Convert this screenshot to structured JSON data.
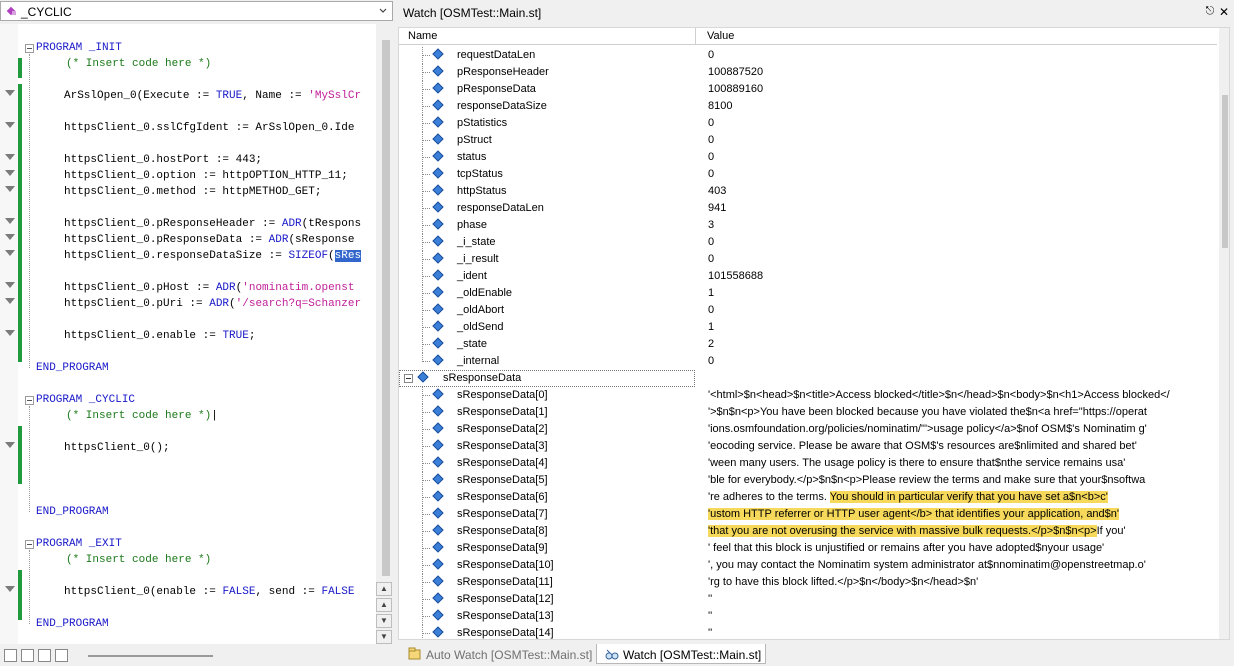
{
  "editor": {
    "combo_value": "_CYCLIC",
    "code": {
      "prog_init": "PROGRAM _INIT",
      "comment": "(* Insert code here *)",
      "l_sslopen": [
        "ArSslOpen_0(Execute := ",
        "TRUE",
        ", Name := ",
        "'MySslCr"
      ],
      "l_cfgident": "httpsClient_0.sslCfgIdent := ArSslOpen_0.Ide",
      "l_hostport": "httpsClient_0.hostPort := 443;",
      "l_option": "httpsClient_0.option := httpOPTION_HTTP_11;",
      "l_method": "httpsClient_0.method := httpMETHOD_GET;",
      "l_resphdr": [
        "httpsClient_0.pResponseHeader := ",
        "ADR",
        "(tRespons"
      ],
      "l_respdata": [
        "httpsClient_0.pResponseData := ",
        "ADR",
        "(sResponse"
      ],
      "l_respsize": [
        "httpsClient_0.responseDataSize := ",
        "SIZEOF",
        "(",
        "sRes"
      ],
      "l_phost": [
        "httpsClient_0.pHost := ",
        "ADR",
        "(",
        "'nominatim.openst"
      ],
      "l_puri": [
        "httpsClient_0.pUri := ",
        "ADR",
        "(",
        "'/search?q=Schanzer"
      ],
      "l_enable": [
        "httpsClient_0.enable := ",
        "TRUE",
        ";"
      ],
      "end_program": "END_PROGRAM",
      "prog_cyclic": "PROGRAM _CYCLIC",
      "l_call": "httpsClient_0();",
      "prog_exit": "PROGRAM _EXIT",
      "l_exit": [
        "httpsClient_0(enable := ",
        "FALSE",
        ", send := ",
        "FALSE"
      ]
    }
  },
  "watch": {
    "title": "Watch [OSMTest::Main.st]",
    "col_name": "Name",
    "col_value": "Value",
    "group_name": "sResponseData",
    "fields": [
      {
        "name": "requestDataLen",
        "value": "0"
      },
      {
        "name": "pResponseHeader",
        "value": "100887520"
      },
      {
        "name": "pResponseData",
        "value": "100889160"
      },
      {
        "name": "responseDataSize",
        "value": "8100"
      },
      {
        "name": "pStatistics",
        "value": "0"
      },
      {
        "name": "pStruct",
        "value": "0"
      },
      {
        "name": "status",
        "value": "0"
      },
      {
        "name": "tcpStatus",
        "value": "0"
      },
      {
        "name": "httpStatus",
        "value": "403"
      },
      {
        "name": "responseDataLen",
        "value": "941"
      },
      {
        "name": "phase",
        "value": "3"
      },
      {
        "name": "_i_state",
        "value": "0"
      },
      {
        "name": "_i_result",
        "value": "0"
      },
      {
        "name": "_ident",
        "value": "101558688"
      },
      {
        "name": "_oldEnable",
        "value": "1"
      },
      {
        "name": "_oldAbort",
        "value": "0"
      },
      {
        "name": "_oldSend",
        "value": "1"
      },
      {
        "name": "_state",
        "value": "2"
      },
      {
        "name": "_internal",
        "value": "0"
      }
    ],
    "resp": [
      {
        "name": "sResponseData[0]",
        "value": "'<html>$n<head>$n<title>Access blocked</title>$n</head>$n<body>$n<h1>Access blocked</",
        "hl": ""
      },
      {
        "name": "sResponseData[1]",
        "value": "'>$n$n<p>You have been blocked because you have violated the$n<a href=\"https://operat",
        "hl": ""
      },
      {
        "name": "sResponseData[2]",
        "value": "'ions.osmfoundation.org/policies/nominatim/\"'>usage policy</a>$nof OSM$'s Nominatim g'",
        "hl": ""
      },
      {
        "name": "sResponseData[3]",
        "value": "'eocoding service. Please be aware that OSM$'s resources are$nlimited and shared bet'",
        "hl": ""
      },
      {
        "name": "sResponseData[4]",
        "value": "'ween many users. The usage policy is there to ensure that$nthe service remains usa'",
        "hl": ""
      },
      {
        "name": "sResponseData[5]",
        "value": "'ble for everybody.</p>$n$n<p>Please review the terms and make sure that your$nsoftwa",
        "hl": ""
      },
      {
        "name": "sResponseData[6]",
        "value": "'re adheres to the terms. ",
        "hl": "You should in particular verify that you have set a$n<b>c'"
      },
      {
        "name": "sResponseData[7]",
        "value": "",
        "hl": "'ustom HTTP referrer or HTTP user agent</b> that identifies your application, and$n'"
      },
      {
        "name": "sResponseData[8]",
        "value": "",
        "hl": "'that you are not overusing the service with massive bulk requests.</p>$n$n<p>",
        "tail": "If you'"
      },
      {
        "name": "sResponseData[9]",
        "value": "' feel that this block is unjustified or remains after you have adopted$nyour usage'",
        "hl": ""
      },
      {
        "name": "sResponseData[10]",
        "value": "', you may contact the Nominatim system administrator at$nnominatim@openstreetmap.o'",
        "hl": ""
      },
      {
        "name": "sResponseData[11]",
        "value": "'rg to have this block lifted.</p>$n</body>$n</head>$n'",
        "hl": ""
      },
      {
        "name": "sResponseData[12]",
        "value": "''",
        "hl": ""
      },
      {
        "name": "sResponseData[13]",
        "value": "''",
        "hl": ""
      },
      {
        "name": "sResponseData[14]",
        "value": "''",
        "hl": ""
      }
    ]
  },
  "tabs": {
    "auto_watch": "Auto Watch [OSMTest::Main.st]",
    "watch": "Watch [OSMTest::Main.st]"
  },
  "colors": {
    "keyword": "#1818c8",
    "comment": "#1a7a1a",
    "string": "#c0209a",
    "highlight": "#f6d95a",
    "gutter_bar": "#1f9a3c"
  }
}
